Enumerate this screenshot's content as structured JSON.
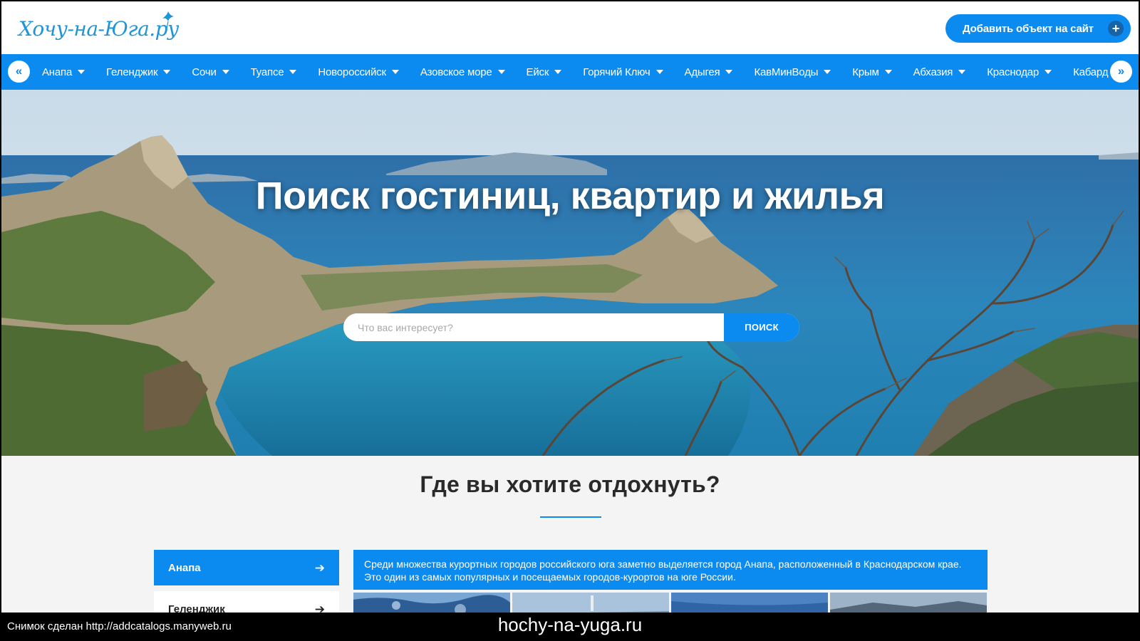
{
  "header": {
    "logo_text": "Хочу-на-Юга.ру",
    "add_button_label": "Добавить объект на сайт",
    "add_button_icon": "+"
  },
  "nav": {
    "prev_label": "«",
    "next_label": "»",
    "items": [
      {
        "label": "Анапа"
      },
      {
        "label": "Геленджик"
      },
      {
        "label": "Сочи"
      },
      {
        "label": "Туапсе"
      },
      {
        "label": "Новороссийск"
      },
      {
        "label": "Азовское море"
      },
      {
        "label": "Ейск"
      },
      {
        "label": "Горячий Ключ"
      },
      {
        "label": "Адыгея"
      },
      {
        "label": "КавМинВоды"
      },
      {
        "label": "Крым"
      },
      {
        "label": "Абхазия"
      },
      {
        "label": "Краснодар"
      },
      {
        "label": "Кабардино-Балкария"
      }
    ]
  },
  "hero": {
    "title": "Поиск гостиниц, квартир и жилья",
    "search_placeholder": "Что вас интересует?",
    "search_value": "",
    "search_button_label": "ПОИСК"
  },
  "section": {
    "title": "Где вы хотите отдохнуть?",
    "cities": [
      {
        "label": "Анапа",
        "arrow": "➔",
        "active": true
      },
      {
        "label": "Геленджик",
        "arrow": "➔",
        "active": false
      }
    ],
    "description": "Среди множества курортных городов российского юга заметно выделяется город Анапа, расположенный в Краснодарском крае. Это один из самых популярных и посещаемых городов-курортов на юге России."
  },
  "capture_bar": {
    "left_text": "Снимок сделан http://addcatalogs.manyweb.ru",
    "center_text": "hochy-na-yuga.ru"
  },
  "colors": {
    "accent": "#0b8af0",
    "background": "#f4f4f4",
    "text_dark": "#2a2a2a"
  },
  "icons": {
    "add_button": "plus-icon",
    "nav_prev": "chevron-double-left-icon",
    "nav_next": "chevron-double-right-icon",
    "nav_dropdown": "caret-down-icon",
    "city_arrow": "arrow-right-icon",
    "logo_decoration": "swallow-bird-icon"
  }
}
